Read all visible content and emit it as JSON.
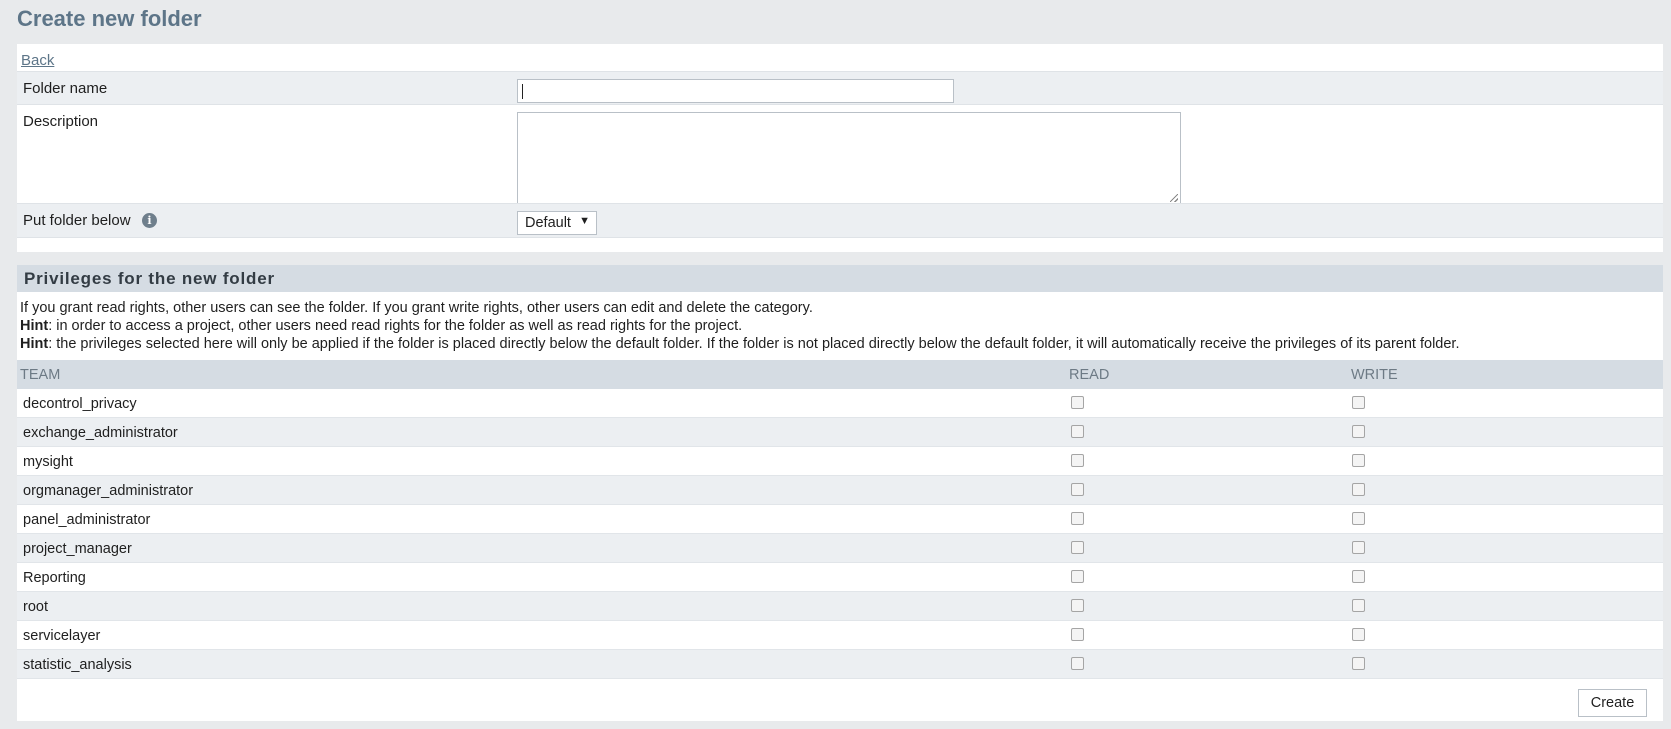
{
  "page": {
    "title": "Create new folder",
    "back_label": "Back"
  },
  "form": {
    "folder_name_label": "Folder name",
    "folder_name_value": "",
    "description_label": "Description",
    "description_value": "",
    "put_below_label": "Put folder below",
    "put_below_selected": "Default",
    "info_icon": "info-icon"
  },
  "privileges": {
    "header": "Privileges for the new folder",
    "intro": "If you grant read rights, other users can see the folder. If you grant write rights, other users can edit and delete the category.",
    "hint_label": "Hint",
    "hint1": ": in order to access a project, other users need read rights for the folder as well as read rights for the project.",
    "hint2": ": the privileges selected here will only be applied if the folder is placed directly below the default folder. If the folder is not placed directly below the default folder, it will automatically receive the privileges of its parent folder.",
    "columns": {
      "team": "TEAM",
      "read": "READ",
      "write": "WRITE"
    },
    "teams": [
      {
        "name": "decontrol_privacy",
        "read": false,
        "write": false
      },
      {
        "name": "exchange_administrator",
        "read": false,
        "write": false
      },
      {
        "name": "mysight",
        "read": false,
        "write": false
      },
      {
        "name": "orgmanager_administrator",
        "read": false,
        "write": false
      },
      {
        "name": "panel_administrator",
        "read": false,
        "write": false
      },
      {
        "name": "project_manager",
        "read": false,
        "write": false
      },
      {
        "name": "Reporting",
        "read": false,
        "write": false
      },
      {
        "name": "root",
        "read": false,
        "write": false
      },
      {
        "name": "servicelayer",
        "read": false,
        "write": false
      },
      {
        "name": "statistic_analysis",
        "read": false,
        "write": false
      }
    ]
  },
  "actions": {
    "create_label": "Create"
  },
  "colors": {
    "title": "#5d7588",
    "header_bg": "#d5dce3",
    "row_alt": "#eceff2",
    "page_bg": "#e8eaec"
  }
}
